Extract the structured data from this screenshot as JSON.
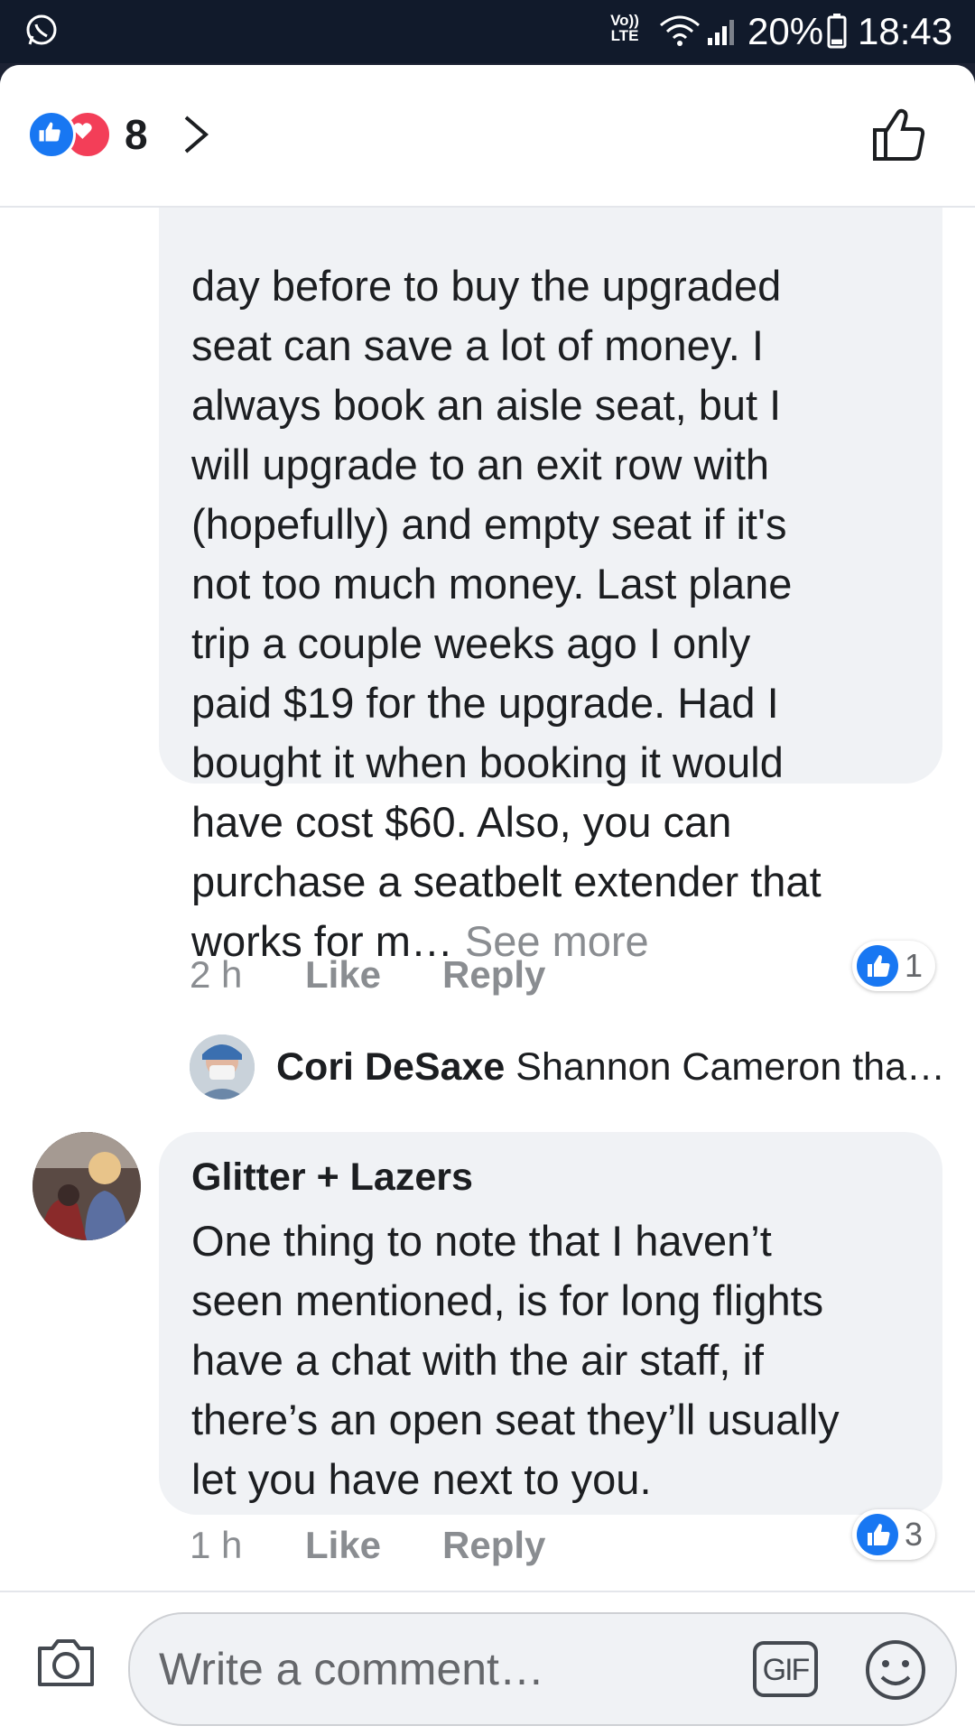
{
  "status_bar": {
    "network_label": "Vo)) LTE",
    "battery_percent": "20%",
    "time": "18:43",
    "battery_level": 0.2,
    "icons": [
      "whatsapp-icon",
      "wifi-icon",
      "signal-icon",
      "battery-icon"
    ]
  },
  "header": {
    "reaction_count": "8",
    "reaction_types": [
      "like",
      "love"
    ],
    "icons": [
      "chevron-right-icon",
      "thumbs-up-outline-icon"
    ]
  },
  "comments": [
    {
      "text": "day before to buy the upgraded\nseat can save a lot of money. I\nalways book an aisle seat, but I\nwill upgrade to an exit row with\n(hopefully) and empty seat if it's\nnot too much money. Last plane\ntrip a couple weeks ago I only\npaid $19 for the upgrade. Had I\nbought it when booking it would\nhave cost $60. Also, you can\npurchase a seatbelt extender that\nworks for m…",
      "see_more": "See more",
      "time": "2 h",
      "like_label": "Like",
      "reply_label": "Reply",
      "like_count": "1"
    },
    {
      "author": "Glitter + Lazers",
      "text": "One thing to note that I haven’t\nseen mentioned, is for long flights\nhave a chat with the air staff, if\nthere’s an open seat they’ll usually\nlet you have next to you.",
      "time": "1 h",
      "like_label": "Like",
      "reply_label": "Reply",
      "like_count": "3"
    }
  ],
  "reply_preview": {
    "author": "Cori DeSaxe",
    "snippet": "Shannon Cameron tha…"
  },
  "composer": {
    "placeholder": "Write a comment…",
    "gif_label": "GIF",
    "icons": [
      "camera-icon",
      "emoji-icon"
    ]
  },
  "colors": {
    "facebook_blue": "#1877f2",
    "love_red": "#f33e58",
    "bubble_gray": "#f0f2f5",
    "muted_text": "#8a8d91"
  }
}
